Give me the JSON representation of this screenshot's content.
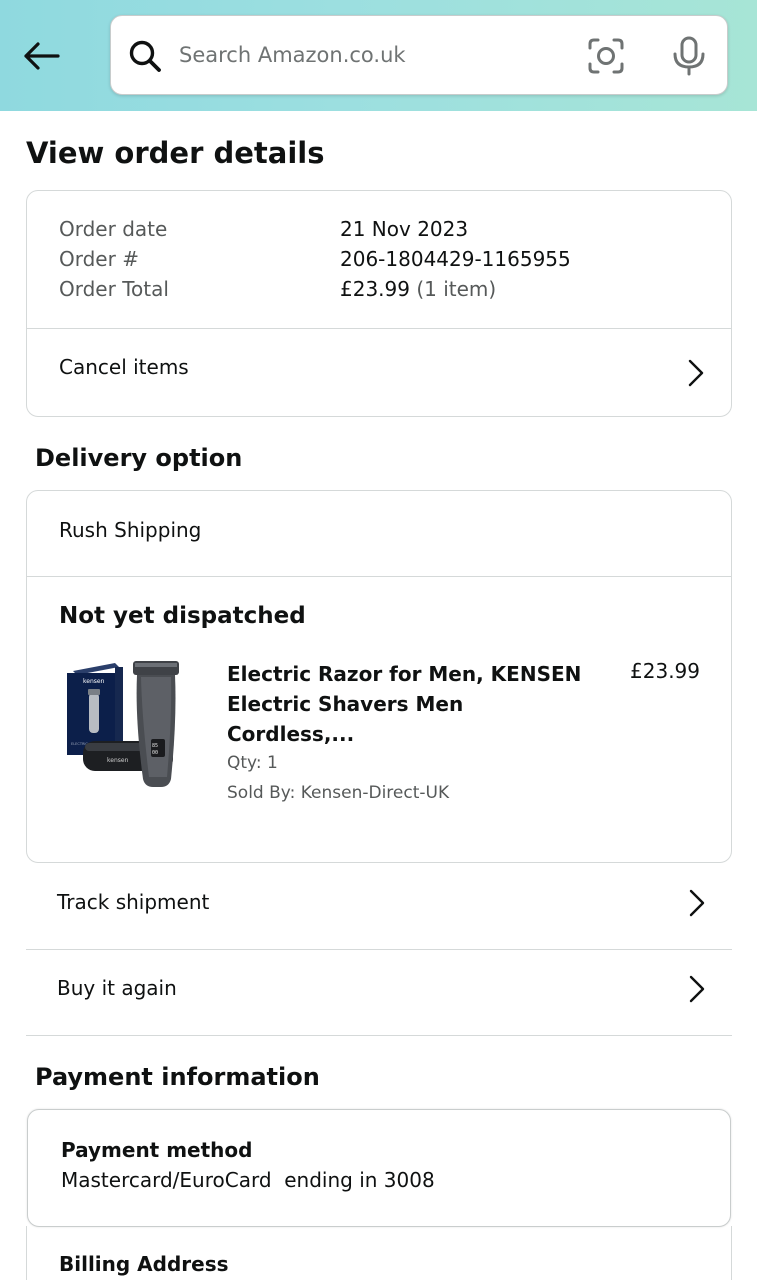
{
  "header": {
    "search_placeholder": "Search Amazon.co.uk",
    "icons": [
      "back-arrow-icon",
      "search-icon",
      "camera-scan-icon",
      "microphone-icon"
    ],
    "gradient_colors": [
      "#8fd9df",
      "#a7e5d6"
    ]
  },
  "page_title": "View order details",
  "order_summary": {
    "date_label": "Order date",
    "date_value": "21 Nov 2023",
    "number_label": "Order #",
    "number_value": "206-1804429-1165955",
    "total_label": "Order Total",
    "total_value": "£23.99",
    "total_items": "(1 item)",
    "cancel_label": "Cancel items"
  },
  "delivery": {
    "section_title": "Delivery option",
    "option": "Rush Shipping",
    "status": "Not yet dispatched",
    "item": {
      "title": "Electric Razor for Men, KENSEN Electric Shavers Men Cordless,...",
      "price": "£23.99",
      "qty": "Qty: 1",
      "seller": "Sold By: Kensen-Direct-UK"
    },
    "track_label": "Track shipment",
    "buy_again_label": "Buy it again"
  },
  "payment": {
    "section_title": "Payment information",
    "method_label": "Payment method",
    "method_value": "Mastercard/EuroCard  ending in 3008",
    "billing_label": "Billing Address"
  }
}
